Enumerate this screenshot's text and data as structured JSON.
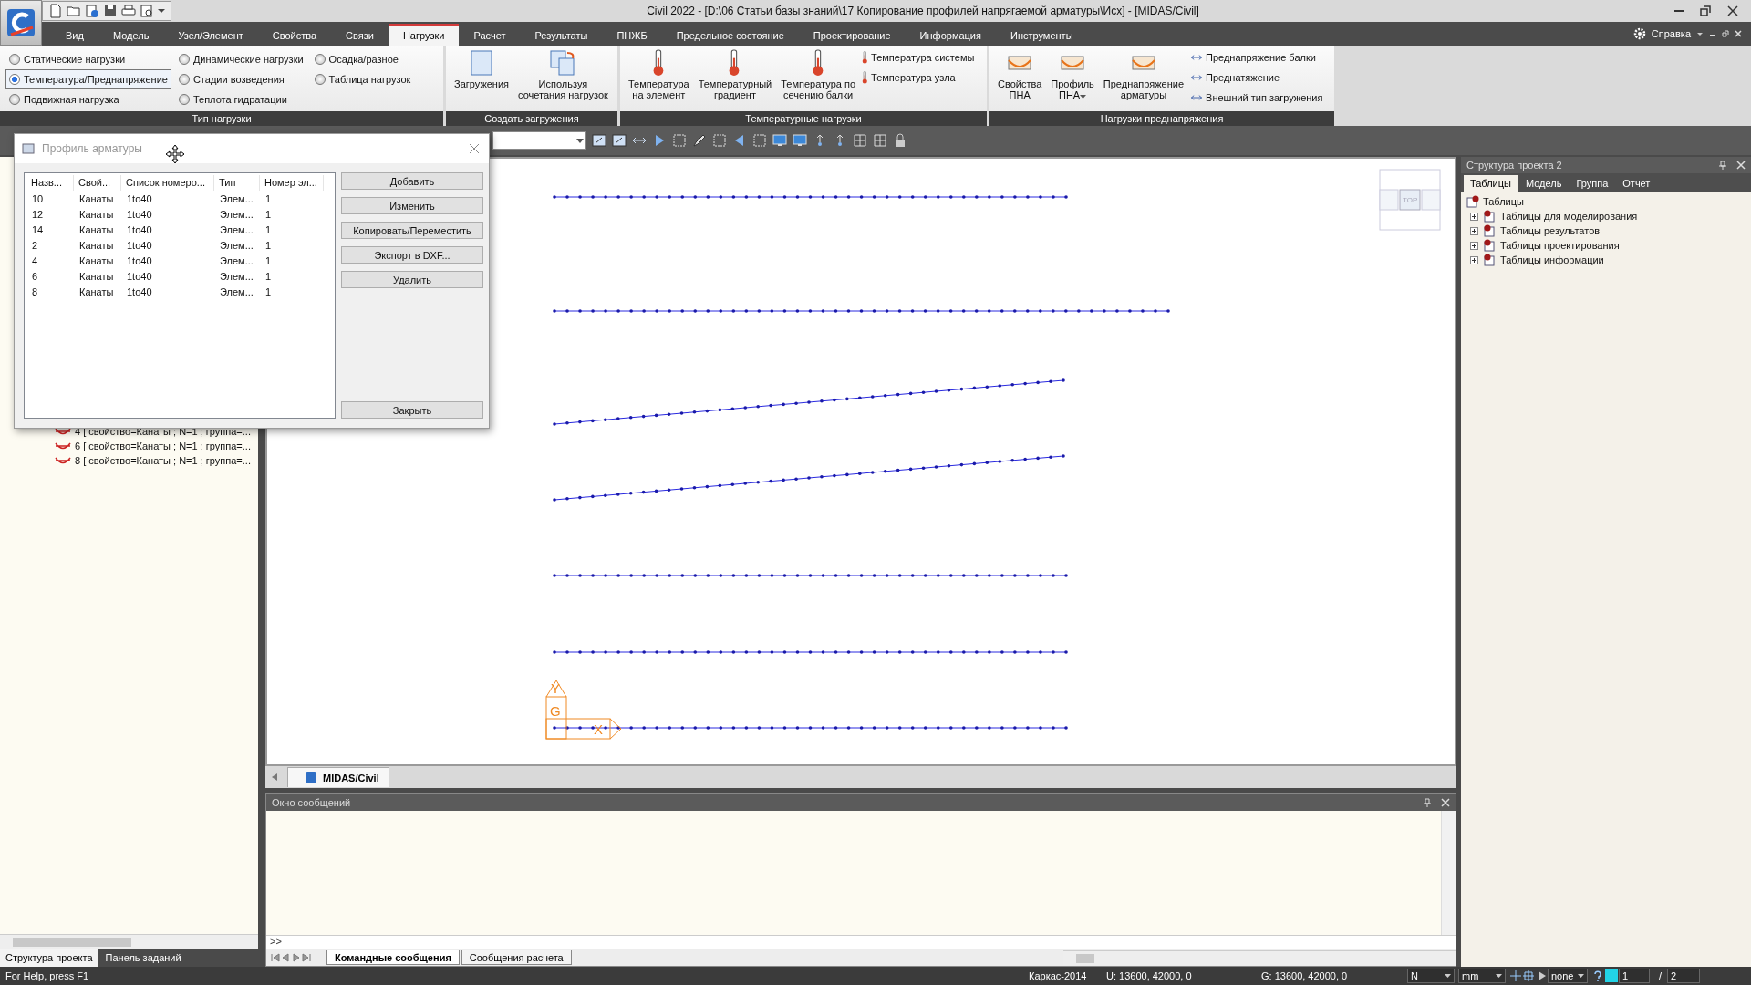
{
  "title_bar": {
    "title": "Civil 2022 - [D:\\06 Статьи базы знаний\\17 Копирование профилей напрягаемой арматуры\\Исх] - [MIDAS/Civil]"
  },
  "menu_tabs": [
    {
      "label": "Вид",
      "selected": false
    },
    {
      "label": "Модель",
      "selected": false
    },
    {
      "label": "Узел/Элемент",
      "selected": false
    },
    {
      "label": "Свойства",
      "selected": false
    },
    {
      "label": "Связи",
      "selected": false
    },
    {
      "label": "Нагрузки",
      "selected": true
    },
    {
      "label": "Расчет",
      "selected": false
    },
    {
      "label": "Результаты",
      "selected": false
    },
    {
      "label": "ПНЖБ",
      "selected": false
    },
    {
      "label": "Предельное состояние",
      "selected": false
    },
    {
      "label": "Проектирование",
      "selected": false
    },
    {
      "label": "Информация",
      "selected": false
    },
    {
      "label": "Инструменты",
      "selected": false
    }
  ],
  "help_menu": "Справка",
  "ribbon": {
    "groups": [
      {
        "label": "Тип нагрузки",
        "radios": [
          {
            "label": "Статические нагрузки",
            "selected": false
          },
          {
            "label": "Температура/Преднапряжение",
            "selected": true
          },
          {
            "label": "Подвижная нагрузка",
            "selected": false
          },
          {
            "label": "Динамические нагрузки",
            "selected": false
          },
          {
            "label": "Стадии возведения",
            "selected": false
          },
          {
            "label": "Теплота гидратации",
            "selected": false
          },
          {
            "label": "Осадка/разное",
            "selected": false
          },
          {
            "label": "Таблица нагрузок",
            "selected": false
          }
        ]
      },
      {
        "label": "Создать загружения",
        "large": [
          {
            "label": "Загружения"
          },
          {
            "label": "Используя\nсочетания нагрузок"
          }
        ]
      },
      {
        "label": "Температурные нагрузки",
        "large": [
          {
            "label": "Температура\nна элемент"
          },
          {
            "label": "Температурный\nградиент"
          },
          {
            "label": "Температура по\nсечению балки"
          }
        ],
        "small": [
          {
            "label": "Температура системы"
          },
          {
            "label": "Температура узла"
          }
        ]
      },
      {
        "label": "Нагрузки преднапряжения",
        "large": [
          {
            "label": "Свойства\nПНА"
          },
          {
            "label": "Профиль\nПНА",
            "dropdown": true
          },
          {
            "label": "Преднапряжение\nарматуры"
          }
        ],
        "small": [
          {
            "label": "Преднапряжение балки"
          },
          {
            "label": "Преднатяжение"
          },
          {
            "label": "Внешний тип загружения"
          }
        ]
      }
    ]
  },
  "dialog": {
    "title": "Профиль арматуры",
    "columns": [
      "Назв...",
      "Свой...",
      "Список номеро...",
      "Тип",
      "Номер эл..."
    ],
    "rows": [
      [
        "10",
        "Канаты",
        "1to40",
        "Элем...",
        "1"
      ],
      [
        "12",
        "Канаты",
        "1to40",
        "Элем...",
        "1"
      ],
      [
        "14",
        "Канаты",
        "1to40",
        "Элем...",
        "1"
      ],
      [
        "2",
        "Канаты",
        "1to40",
        "Элем...",
        "1"
      ],
      [
        "4",
        "Канаты",
        "1to40",
        "Элем...",
        "1"
      ],
      [
        "6",
        "Канаты",
        "1to40",
        "Элем...",
        "1"
      ],
      [
        "8",
        "Канаты",
        "1to40",
        "Элем...",
        "1"
      ]
    ],
    "buttons": [
      "Добавить",
      "Изменить",
      "Копировать/Переместить",
      "Экспорт в DXF...",
      "Удалить"
    ],
    "close_button": "Закрыть"
  },
  "left_panel": {
    "tree_items": [
      "4 [ свойство=Канаты ; N=1 ; группа=...",
      "6 [ свойство=Канаты ; N=1 ; группа=...",
      "8 [ свойство=Канаты ; N=1 ; группа=..."
    ],
    "tabs": [
      {
        "label": "Структура проекта",
        "selected": true
      },
      {
        "label": "Панель заданий",
        "selected": false
      }
    ]
  },
  "viewport": {
    "tab": "MIDAS/Civil",
    "axis_labels": [
      "Y",
      "G",
      "X"
    ],
    "view_cube_label": "TOP"
  },
  "messages": {
    "title": "Окно сообщений",
    "prompt": ">>",
    "tabs": [
      {
        "label": "Командные сообщения",
        "selected": true
      },
      {
        "label": "Сообщения расчета",
        "selected": false
      }
    ]
  },
  "right_panel": {
    "title": "Структура проекта  2",
    "tabs": [
      {
        "label": "Таблицы",
        "selected": true
      },
      {
        "label": "Модель",
        "selected": false
      },
      {
        "label": "Группа",
        "selected": false
      },
      {
        "label": "Отчет",
        "selected": false
      }
    ],
    "tree": {
      "label": "Таблицы",
      "children": [
        {
          "label": "Таблицы для моделирования",
          "expanded": false
        },
        {
          "label": "Таблицы результатов",
          "expanded": false
        },
        {
          "label": "Таблицы проектирования",
          "expanded": false
        },
        {
          "label": "Таблицы информации",
          "expanded": false
        }
      ]
    }
  },
  "status_bar": {
    "help": "For Help, press F1",
    "frame": "Каркас-2014",
    "ucs": "U: 13600, 42000, 0",
    "gcs": "G: 13600, 42000, 0",
    "force_unit": "N",
    "length_unit": "mm",
    "display": "none",
    "page": "1",
    "separator": "/",
    "total": "2"
  }
}
